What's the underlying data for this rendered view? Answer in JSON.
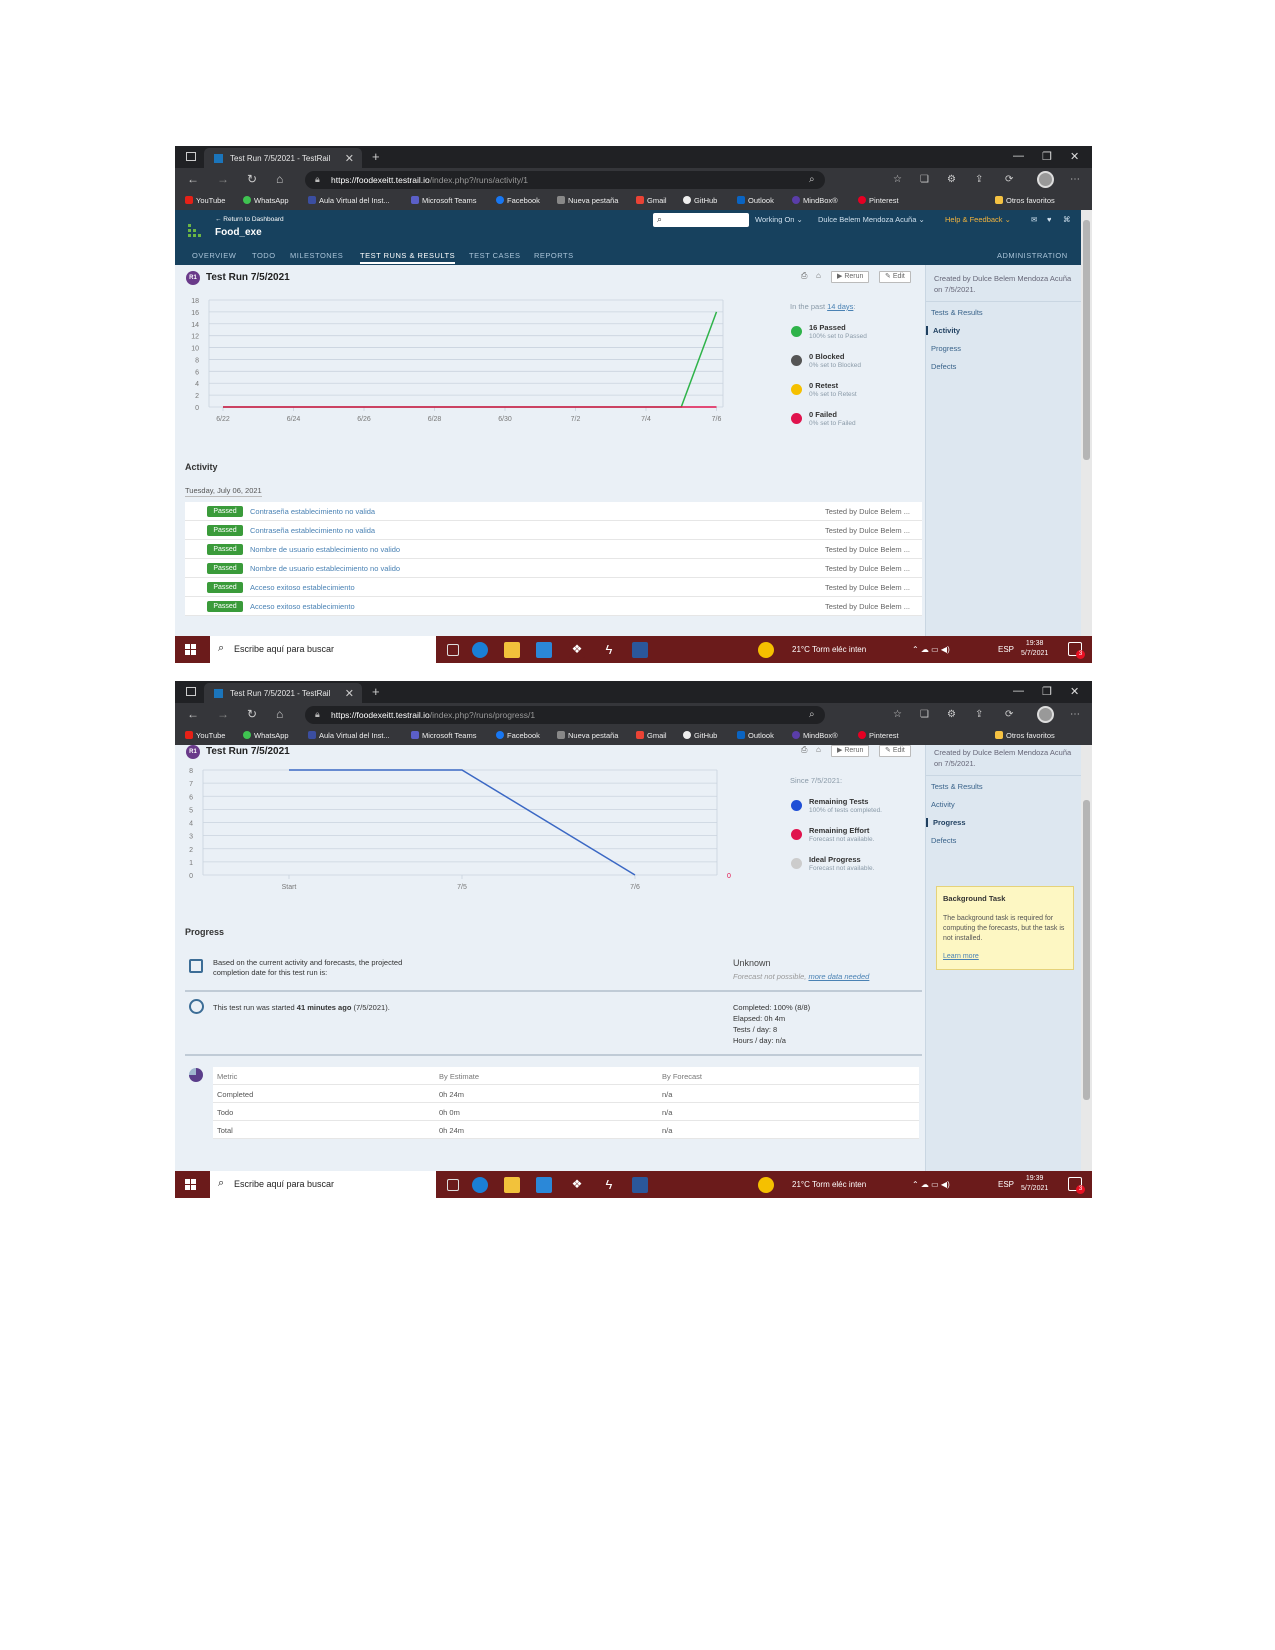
{
  "browser": {
    "tab_title_1": "Test Run 7/5/2021 - TestRail",
    "tab_title_2": "Test Run 7/5/2021 - TestRail",
    "url_host": "https://foodexeitt.testrail.io",
    "url_path_1": "/index.php?/runs/activity/1",
    "url_path_2": "/index.php?/runs/progress/1",
    "favorites": [
      "YouTube",
      "WhatsApp",
      "Aula Virtual del Inst...",
      "Microsoft Teams",
      "Facebook",
      "Nueva pestaña",
      "Gmail",
      "GitHub",
      "Outlook",
      "MindBox®",
      "Pinterest"
    ],
    "other_favorites": "Otros favoritos"
  },
  "app": {
    "back_link": "← Return to Dashboard",
    "project": "Food_exe",
    "working_on": "Working On",
    "user": "Dulce Belem Mendoza Acuña",
    "help": "Help & Feedback",
    "menu": [
      "OVERVIEW",
      "TODO",
      "MILESTONES",
      "TEST RUNS & RESULTS",
      "TEST CASES",
      "REPORTS"
    ],
    "admin": "ADMINISTRATION"
  },
  "run": {
    "badge": "R1",
    "title": "Test Run 7/5/2021",
    "rerun": "Rerun",
    "edit": "Edit",
    "created": "Created by Dulce Belem Mendoza Acuña on 7/5/2021.",
    "side_nav": [
      "Tests & Results",
      "Activity",
      "Progress",
      "Defects"
    ]
  },
  "activity": {
    "since_prefix": "In the past",
    "since_link": "14 days",
    "since_suffix": ":",
    "legend": [
      {
        "title": "16 Passed",
        "sub": "100% set to Passed",
        "color": "#2fb34a"
      },
      {
        "title": "0 Blocked",
        "sub": "0% set to Blocked",
        "color": "#555555"
      },
      {
        "title": "0 Retest",
        "sub": "0% set to Retest",
        "color": "#f5c000"
      },
      {
        "title": "0 Failed",
        "sub": "0% set to Failed",
        "color": "#e0134d"
      }
    ],
    "section": "Activity",
    "date": "Tuesday, July 06, 2021",
    "rows": [
      {
        "status": "Passed",
        "name": "Contraseña establecimiento no valida",
        "by": "Tested by Dulce Belem ..."
      },
      {
        "status": "Passed",
        "name": "Contraseña establecimiento no valida",
        "by": "Tested by Dulce Belem ..."
      },
      {
        "status": "Passed",
        "name": "Nombre de usuario establecimiento no valido",
        "by": "Tested by Dulce Belem ..."
      },
      {
        "status": "Passed",
        "name": "Nombre de usuario establecimiento no valido",
        "by": "Tested by Dulce Belem ..."
      },
      {
        "status": "Passed",
        "name": "Acceso exitoso establecimiento",
        "by": "Tested by Dulce Belem ..."
      },
      {
        "status": "Passed",
        "name": "Acceso exitoso establecimiento",
        "by": "Tested by Dulce Belem ..."
      }
    ]
  },
  "progress": {
    "since": "Since 7/5/2021:",
    "legend": [
      {
        "title": "Remaining Tests",
        "sub": "100% of tests completed.",
        "color": "#1f4fd6"
      },
      {
        "title": "Remaining Effort",
        "sub": "Forecast not available.",
        "color": "#e0134d"
      },
      {
        "title": "Ideal Progress",
        "sub": "Forecast not available.",
        "color": "#cccccc"
      }
    ],
    "section": "Progress",
    "forecast_text": "Based on the current activity and forecasts, the projected completion date for this test run is:",
    "forecast_value": "Unknown",
    "forecast_note": "Forecast not possible,",
    "forecast_link": "more data needed",
    "started_prefix": "This test run was started",
    "started_bold": "41 minutes ago",
    "started_suffix": "(7/5/2021).",
    "stats": [
      "Completed: 100% (8/8)",
      "Elapsed: 0h 4m",
      "Tests / day: 8",
      "Hours / day: n/a"
    ],
    "metrics_header": [
      "Metric",
      "By Estimate",
      "By Forecast"
    ],
    "metrics": [
      [
        "Completed",
        "0h 24m",
        "n/a"
      ],
      [
        "Todo",
        "0h 0m",
        "n/a"
      ],
      [
        "Total",
        "0h 24m",
        "n/a"
      ]
    ],
    "bg_task_title": "Background Task",
    "bg_task_body": "The background task is required for computing the forecasts, but the task is not installed.",
    "bg_task_link": "Learn more"
  },
  "taskbar": {
    "search_placeholder": "Escribe aquí para buscar",
    "weather": "21°C  Torm eléc inten",
    "lang": "ESP",
    "time_1": "19:38",
    "time_2": "19:39",
    "date": "5/7/2021",
    "notif_count": "3"
  },
  "chart_data": [
    {
      "type": "line",
      "x": [
        "6/22",
        "6/24",
        "6/26",
        "6/28",
        "6/30",
        "7/2",
        "7/4",
        "7/6"
      ],
      "ylim": [
        0,
        18
      ],
      "yticks": [
        0,
        2,
        4,
        6,
        8,
        10,
        12,
        14,
        16,
        18
      ],
      "xticklabels": [
        "6/22",
        "6/24",
        "6/26",
        "6/28",
        "6/30",
        "7/2",
        "7/4",
        "7/6"
      ],
      "series": [
        {
          "name": "Passed",
          "color": "#2fb34a",
          "points": [
            [
              0,
              0
            ],
            [
              6.5,
              0
            ],
            [
              7,
              16
            ]
          ]
        },
        {
          "name": "Failed",
          "color": "#e0134d",
          "points": [
            [
              0,
              0
            ],
            [
              7,
              0
            ]
          ]
        }
      ]
    },
    {
      "type": "line",
      "x": [
        "Start",
        "7/5",
        "7/6"
      ],
      "ylim": [
        0,
        8
      ],
      "yticks": [
        0,
        1,
        2,
        3,
        4,
        5,
        6,
        7,
        8
      ],
      "yticklabels": [
        "0",
        "1",
        "2",
        "3",
        "4",
        "5",
        "6",
        "7",
        "8"
      ],
      "xticklabels": [
        "Start",
        "7/5",
        "7/6"
      ],
      "right_axis_label": "0",
      "series": [
        {
          "name": "Remaining Tests",
          "color": "#3b68c4",
          "points": [
            [
              0,
              8
            ],
            [
              1,
              8
            ],
            [
              2,
              0
            ]
          ]
        }
      ]
    }
  ]
}
